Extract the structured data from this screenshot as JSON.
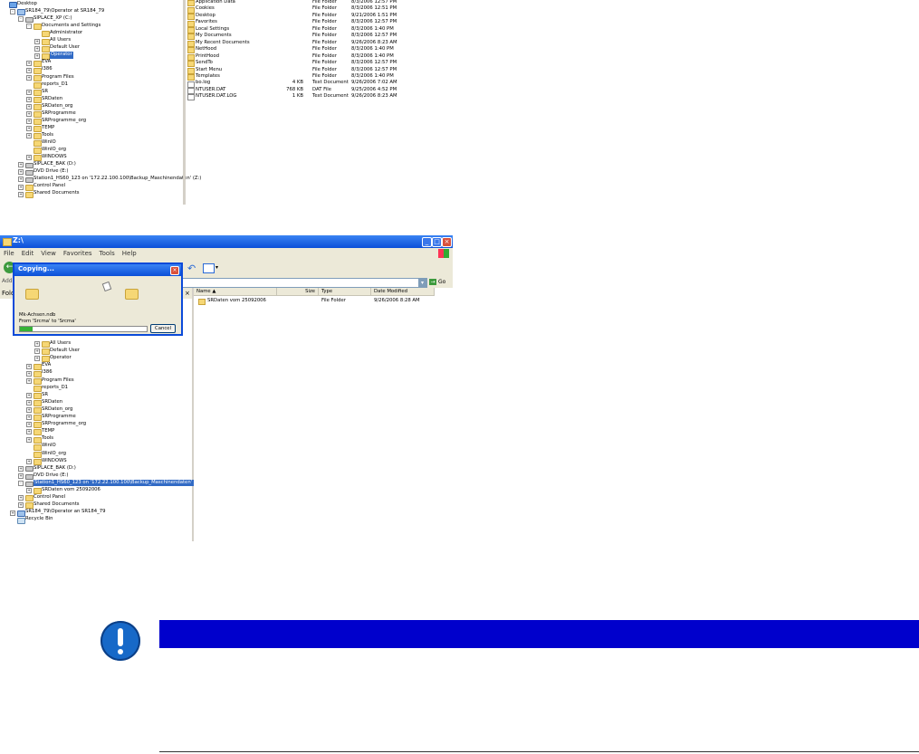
{
  "shot1": {
    "tree": [
      {
        "label": "Desktop",
        "indent": 0,
        "exp": "",
        "icon": "desktop"
      },
      {
        "label": "SR184_79\\Operator at SR184_79",
        "indent": 1,
        "exp": "-",
        "icon": "computer"
      },
      {
        "label": "SIPLACE_XP (C:)",
        "indent": 2,
        "exp": "-",
        "icon": "drive"
      },
      {
        "label": "Documents and Settings",
        "indent": 3,
        "exp": "-",
        "icon": "folder"
      },
      {
        "label": "Administrator",
        "indent": 4,
        "exp": "",
        "icon": "folder"
      },
      {
        "label": "All Users",
        "indent": 4,
        "exp": "+",
        "icon": "folder"
      },
      {
        "label": "Default User",
        "indent": 4,
        "exp": "+",
        "icon": "folder"
      },
      {
        "label": "Operator",
        "indent": 4,
        "exp": "+",
        "icon": "folder",
        "selected": true
      },
      {
        "label": "EVA",
        "indent": 3,
        "exp": "+",
        "icon": "folder"
      },
      {
        "label": "I386",
        "indent": 3,
        "exp": "+",
        "icon": "folder"
      },
      {
        "label": "Program Files",
        "indent": 3,
        "exp": "+",
        "icon": "folder"
      },
      {
        "label": "reports_D1",
        "indent": 3,
        "exp": "",
        "icon": "folder"
      },
      {
        "label": "SR",
        "indent": 3,
        "exp": "+",
        "icon": "folder"
      },
      {
        "label": "SRDaten",
        "indent": 3,
        "exp": "+",
        "icon": "folder"
      },
      {
        "label": "SRDaten_org",
        "indent": 3,
        "exp": "+",
        "icon": "folder"
      },
      {
        "label": "SRProgramme",
        "indent": 3,
        "exp": "+",
        "icon": "folder"
      },
      {
        "label": "SRProgramme_org",
        "indent": 3,
        "exp": "+",
        "icon": "folder"
      },
      {
        "label": "TEMP",
        "indent": 3,
        "exp": "+",
        "icon": "folder"
      },
      {
        "label": "Tools",
        "indent": 3,
        "exp": "+",
        "icon": "folder"
      },
      {
        "label": "WinIO",
        "indent": 3,
        "exp": "",
        "icon": "folder"
      },
      {
        "label": "WinIO_org",
        "indent": 3,
        "exp": "",
        "icon": "folder"
      },
      {
        "label": "WINDOWS",
        "indent": 3,
        "exp": "+",
        "icon": "folder"
      },
      {
        "label": "SIPLACE_BAK (D:)",
        "indent": 2,
        "exp": "+",
        "icon": "drive"
      },
      {
        "label": "DVD Drive (E:)",
        "indent": 2,
        "exp": "+",
        "icon": "drive"
      },
      {
        "label": "Station1_HS60_123 on '172.22.100.100\\Backup_Maschinendaten' (Z:)",
        "indent": 2,
        "exp": "+",
        "icon": "drive"
      },
      {
        "label": "Control Panel",
        "indent": 2,
        "exp": "+",
        "icon": "folder"
      },
      {
        "label": "Shared Documents",
        "indent": 2,
        "exp": "+",
        "icon": "folder"
      }
    ],
    "files": [
      {
        "name": "Application Data",
        "size": "",
        "type": "File Folder",
        "date": "8/3/2006 12:57 PM",
        "doc": false
      },
      {
        "name": "Cookies",
        "size": "",
        "type": "File Folder",
        "date": "8/3/2006 12:51 PM",
        "doc": false
      },
      {
        "name": "Desktop",
        "size": "",
        "type": "File Folder",
        "date": "9/21/2006 1:51 PM",
        "doc": false
      },
      {
        "name": "Favorites",
        "size": "",
        "type": "File Folder",
        "date": "8/3/2006 12:57 PM",
        "doc": false
      },
      {
        "name": "Local Settings",
        "size": "",
        "type": "File Folder",
        "date": "8/3/2006 1:40 PM",
        "doc": false
      },
      {
        "name": "My Documents",
        "size": "",
        "type": "File Folder",
        "date": "8/3/2006 12:57 PM",
        "doc": false
      },
      {
        "name": "My Recent Documents",
        "size": "",
        "type": "File Folder",
        "date": "9/26/2006 8:23 AM",
        "doc": false
      },
      {
        "name": "NetHood",
        "size": "",
        "type": "File Folder",
        "date": "8/3/2006 1:40 PM",
        "doc": false
      },
      {
        "name": "PrintHood",
        "size": "",
        "type": "File Folder",
        "date": "8/3/2006 1:40 PM",
        "doc": false
      },
      {
        "name": "SendTo",
        "size": "",
        "type": "File Folder",
        "date": "8/3/2006 12:57 PM",
        "doc": false
      },
      {
        "name": "Start Menu",
        "size": "",
        "type": "File Folder",
        "date": "8/3/2006 12:57 PM",
        "doc": false
      },
      {
        "name": "Templates",
        "size": "",
        "type": "File Folder",
        "date": "8/3/2006 1:40 PM",
        "doc": false
      },
      {
        "name": "bo.log",
        "size": "4 KB",
        "type": "Text Document",
        "date": "9/26/2006 7:02 AM",
        "doc": true
      },
      {
        "name": "NTUSER.DAT",
        "size": "768 KB",
        "type": "DAT File",
        "date": "9/25/2006 4:52 PM",
        "doc": true
      },
      {
        "name": "NTUSER.DAT.LOG",
        "size": "1 KB",
        "type": "Text Document",
        "date": "9/26/2006 8:23 AM",
        "doc": true
      }
    ]
  },
  "shot2": {
    "window_title": "Z:\\",
    "menu": [
      "File",
      "Edit",
      "View",
      "Favorites",
      "Tools",
      "Help"
    ],
    "address_label": "Address",
    "go_label": "Go",
    "folders_label": "Folders",
    "columns": {
      "name": "Name",
      "size": "Size",
      "type": "Type",
      "date": "Date Modified"
    },
    "file_row": {
      "name": "SRDaten vom 25092006",
      "size": "",
      "type": "File Folder",
      "date": "9/26/2006 8:28 AM"
    },
    "dialog": {
      "title": "Copying...",
      "file": "Mk-Achsen.ndb",
      "from": "From 'Srcma' to 'Srcma'",
      "cancel": "Cancel",
      "progress": 0.1
    },
    "tree": [
      {
        "label": "All Users",
        "indent": 4,
        "exp": "+",
        "icon": "folder"
      },
      {
        "label": "Default User",
        "indent": 4,
        "exp": "+",
        "icon": "folder"
      },
      {
        "label": "Operator",
        "indent": 4,
        "exp": "+",
        "icon": "folder"
      },
      {
        "label": "EVA",
        "indent": 3,
        "exp": "+",
        "icon": "folder"
      },
      {
        "label": "I386",
        "indent": 3,
        "exp": "+",
        "icon": "folder"
      },
      {
        "label": "Program Files",
        "indent": 3,
        "exp": "+",
        "icon": "folder"
      },
      {
        "label": "reports_D1",
        "indent": 3,
        "exp": "",
        "icon": "folder"
      },
      {
        "label": "SR",
        "indent": 3,
        "exp": "+",
        "icon": "folder"
      },
      {
        "label": "SRDaten",
        "indent": 3,
        "exp": "+",
        "icon": "folder"
      },
      {
        "label": "SRDaten_org",
        "indent": 3,
        "exp": "+",
        "icon": "folder"
      },
      {
        "label": "SRProgramme",
        "indent": 3,
        "exp": "+",
        "icon": "folder"
      },
      {
        "label": "SRProgramme_org",
        "indent": 3,
        "exp": "+",
        "icon": "folder"
      },
      {
        "label": "TEMP",
        "indent": 3,
        "exp": "+",
        "icon": "folder"
      },
      {
        "label": "Tools",
        "indent": 3,
        "exp": "+",
        "icon": "folder"
      },
      {
        "label": "WinIO",
        "indent": 3,
        "exp": "",
        "icon": "folder"
      },
      {
        "label": "WinIO_org",
        "indent": 3,
        "exp": "",
        "icon": "folder"
      },
      {
        "label": "WINDOWS",
        "indent": 3,
        "exp": "+",
        "icon": "folder"
      },
      {
        "label": "SIPLACE_BAK (D:)",
        "indent": 2,
        "exp": "+",
        "icon": "drive"
      },
      {
        "label": "DVD Drive (E:)",
        "indent": 2,
        "exp": "+",
        "icon": "drive"
      },
      {
        "label": "Station1_HS60_123 on '172.22.100.100\\Backup_Maschinendaten' (Z:)",
        "indent": 2,
        "exp": "-",
        "icon": "drive",
        "selected": true
      },
      {
        "label": "SRDaten vom 25092006",
        "indent": 3,
        "exp": "+",
        "icon": "folder"
      },
      {
        "label": "Control Panel",
        "indent": 2,
        "exp": "+",
        "icon": "folder"
      },
      {
        "label": "Shared Documents",
        "indent": 2,
        "exp": "+",
        "icon": "folder"
      },
      {
        "label": "SR184_79\\Operator an SR184_79",
        "indent": 1,
        "exp": "+",
        "icon": "computer"
      },
      {
        "label": "Recycle Bin",
        "indent": 1,
        "exp": "",
        "icon": "bin"
      }
    ]
  },
  "colors": {
    "note_bar": "#0000cc",
    "note_icon": "#1769c8",
    "xp_blue": "#0a4fd8"
  }
}
